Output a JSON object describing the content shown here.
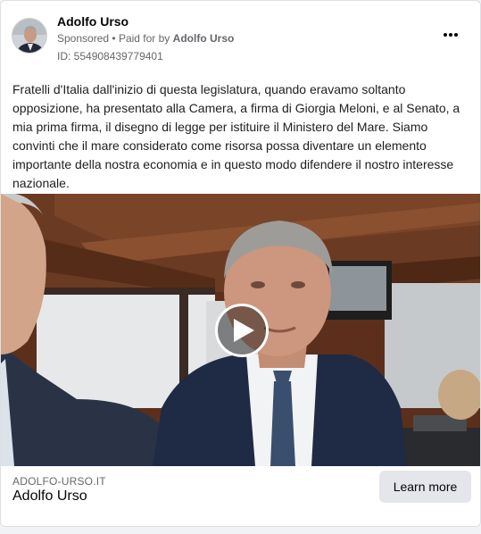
{
  "advertiser": {
    "name": "Adolfo Urso",
    "sponsored_label": "Sponsored",
    "separator": "•",
    "paid_for_prefix": "Paid for by",
    "paid_for_name": "Adolfo Urso",
    "ad_id": "ID: 554908439779401",
    "avatar_icon": "person-portrait-icon",
    "more_icon": "more-options-icon"
  },
  "post": {
    "text": "Fratelli d'Italia dall'inizio di questa legislatura, quando eravamo soltanto opposizione, ha presentato alla Camera, a firma di Giorgia Meloni, e al Senato, a mia prima firma, il disegno di legge per istituire il Ministero del Mare. Siamo convinti che il mare considerato come risorsa possa diventare un elemento importante della nostra economia e in questo modo difendere il nostro interesse nazionale."
  },
  "media": {
    "type": "video",
    "play_icon": "play-icon"
  },
  "footer": {
    "domain": "ADOLFO-URSO.IT",
    "title": "Adolfo Urso",
    "cta_label": "Learn more"
  },
  "colors": {
    "card_bg": "#ffffff",
    "secondary_text": "#65676b",
    "cta_bg": "#e4e6eb",
    "wood": "#5b2f1c"
  }
}
